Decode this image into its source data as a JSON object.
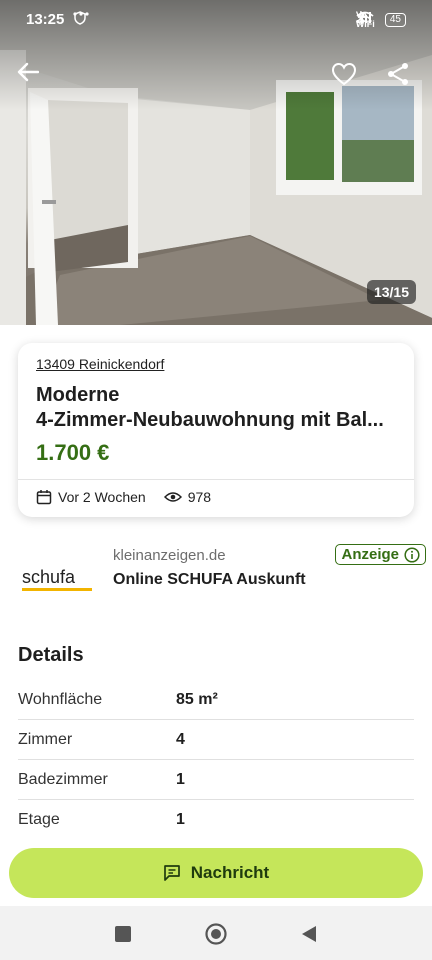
{
  "status_bar": {
    "time": "13:25",
    "left_icons": [
      "vpn-shield-icon",
      "more-dots-icon"
    ],
    "network_label": "Vo WiFi",
    "battery": "45"
  },
  "photo": {
    "counter": "13/15"
  },
  "listing": {
    "location": "13409 Reinickendorf",
    "title_line1": "Moderne",
    "title_line2": "4-Zimmer-Neubauwohnung mit Bal...",
    "price": "1.700 €",
    "date": "Vor 2 Wochen",
    "views": "978"
  },
  "ad": {
    "logo_text": "schufa",
    "domain": "kleinanzeigen.de",
    "title": "Online SCHUFA Auskunft",
    "badge": "Anzeige"
  },
  "details": {
    "heading": "Details",
    "rows": [
      {
        "label": "Wohnfläche",
        "value": "85 m²"
      },
      {
        "label": "Zimmer",
        "value": "4"
      },
      {
        "label": "Badezimmer",
        "value": "1"
      },
      {
        "label": "Etage",
        "value": "1"
      }
    ]
  },
  "action": {
    "message_label": "Nachricht"
  },
  "colors": {
    "accent_green": "#c5e65a",
    "price_green": "#356e14"
  }
}
